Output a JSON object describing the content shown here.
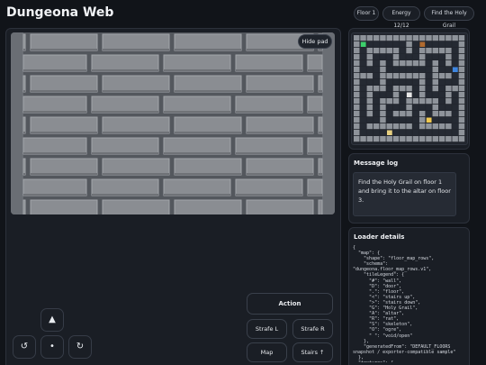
{
  "app": {
    "title": "Dungeona Web"
  },
  "status": {
    "floor": "Floor 1",
    "energy": "Energy 12/12",
    "quest": "Find the Holy Grail"
  },
  "viewport": {
    "hide_pad_label": "Hide pad"
  },
  "message_log": {
    "title": "Message log",
    "text": "Find the Holy Grail on floor 1 and bring it to the altar on floor 3."
  },
  "loader": {
    "title": "Loader details",
    "text": "{\n  \"map\": {\n    \"shape\": \"floor_map_rows\",\n    \"schema\":\n\"dungeona.floor_map_rows.v1\",\n    \"tileLegend\": {\n      \"#\": \"wall\",\n      \"D\": \"door\",\n      \".\": \"floor\",\n      \"<\": \"stairs up\",\n      \">\": \"stairs down\",\n      \"G\": \"Holy Grail\",\n      \"A\": \"altar\",\n      \"R\": \"rat\",\n      \"S\": \"skeleton\",\n      \"O\": \"ogre\",\n      \" \": \"void/open\"\n    },\n    \"generatedFrom\": \"DEFAULT_FLOORS\nsnapshot / exporter-compatible sample\"\n  },\n  \"textures\": {\n    \"schema\": \"unspecified\""
  },
  "controls": {
    "action": "Action",
    "strafe_left": "Strafe L",
    "strafe_right": "Strafe R",
    "map": "Map",
    "stairs": "Stairs ↑",
    "forward_glyph": "▲",
    "turn_left_glyph": "↺",
    "wait_glyph": "•",
    "turn_right_glyph": "↻"
  },
  "minimap": {
    "rows": [
      "#################",
      "#.......#.......#",
      "#.#####.#.#####.#",
      "#.#...#...#...#.#",
      "#.#.#.#####.#.#.#",
      "#...#.......#...#",
      "###.#######.###.#",
      "#...#.....#.#...#",
      "#.###.###.#.#.###",
      "#.#...#...#...#.#",
      "#.#.###.#####.#.#",
      "#.#.#...#...#...#",
      "#.#.#.###.#.###.#",
      "#...#.....#.....#",
      "#.#######.#####.#",
      "#...............#",
      "#################"
    ],
    "wall_color": "#8e939a",
    "floor_color": "#252a33",
    "markers": [
      {
        "type": "player",
        "row": 1,
        "col": 1,
        "color": "#3ccf6b"
      },
      {
        "type": "door",
        "row": 1,
        "col": 10,
        "color": "#b06a2f"
      },
      {
        "type": "stairs",
        "row": 5,
        "col": 15,
        "color": "#3e86e0"
      },
      {
        "type": "altar",
        "row": 9,
        "col": 8,
        "color": "#e8e8e8"
      },
      {
        "type": "grail",
        "row": 13,
        "col": 11,
        "color": "#f0c850"
      },
      {
        "type": "item",
        "row": 15,
        "col": 5,
        "color": "#e6cf80"
      }
    ]
  }
}
